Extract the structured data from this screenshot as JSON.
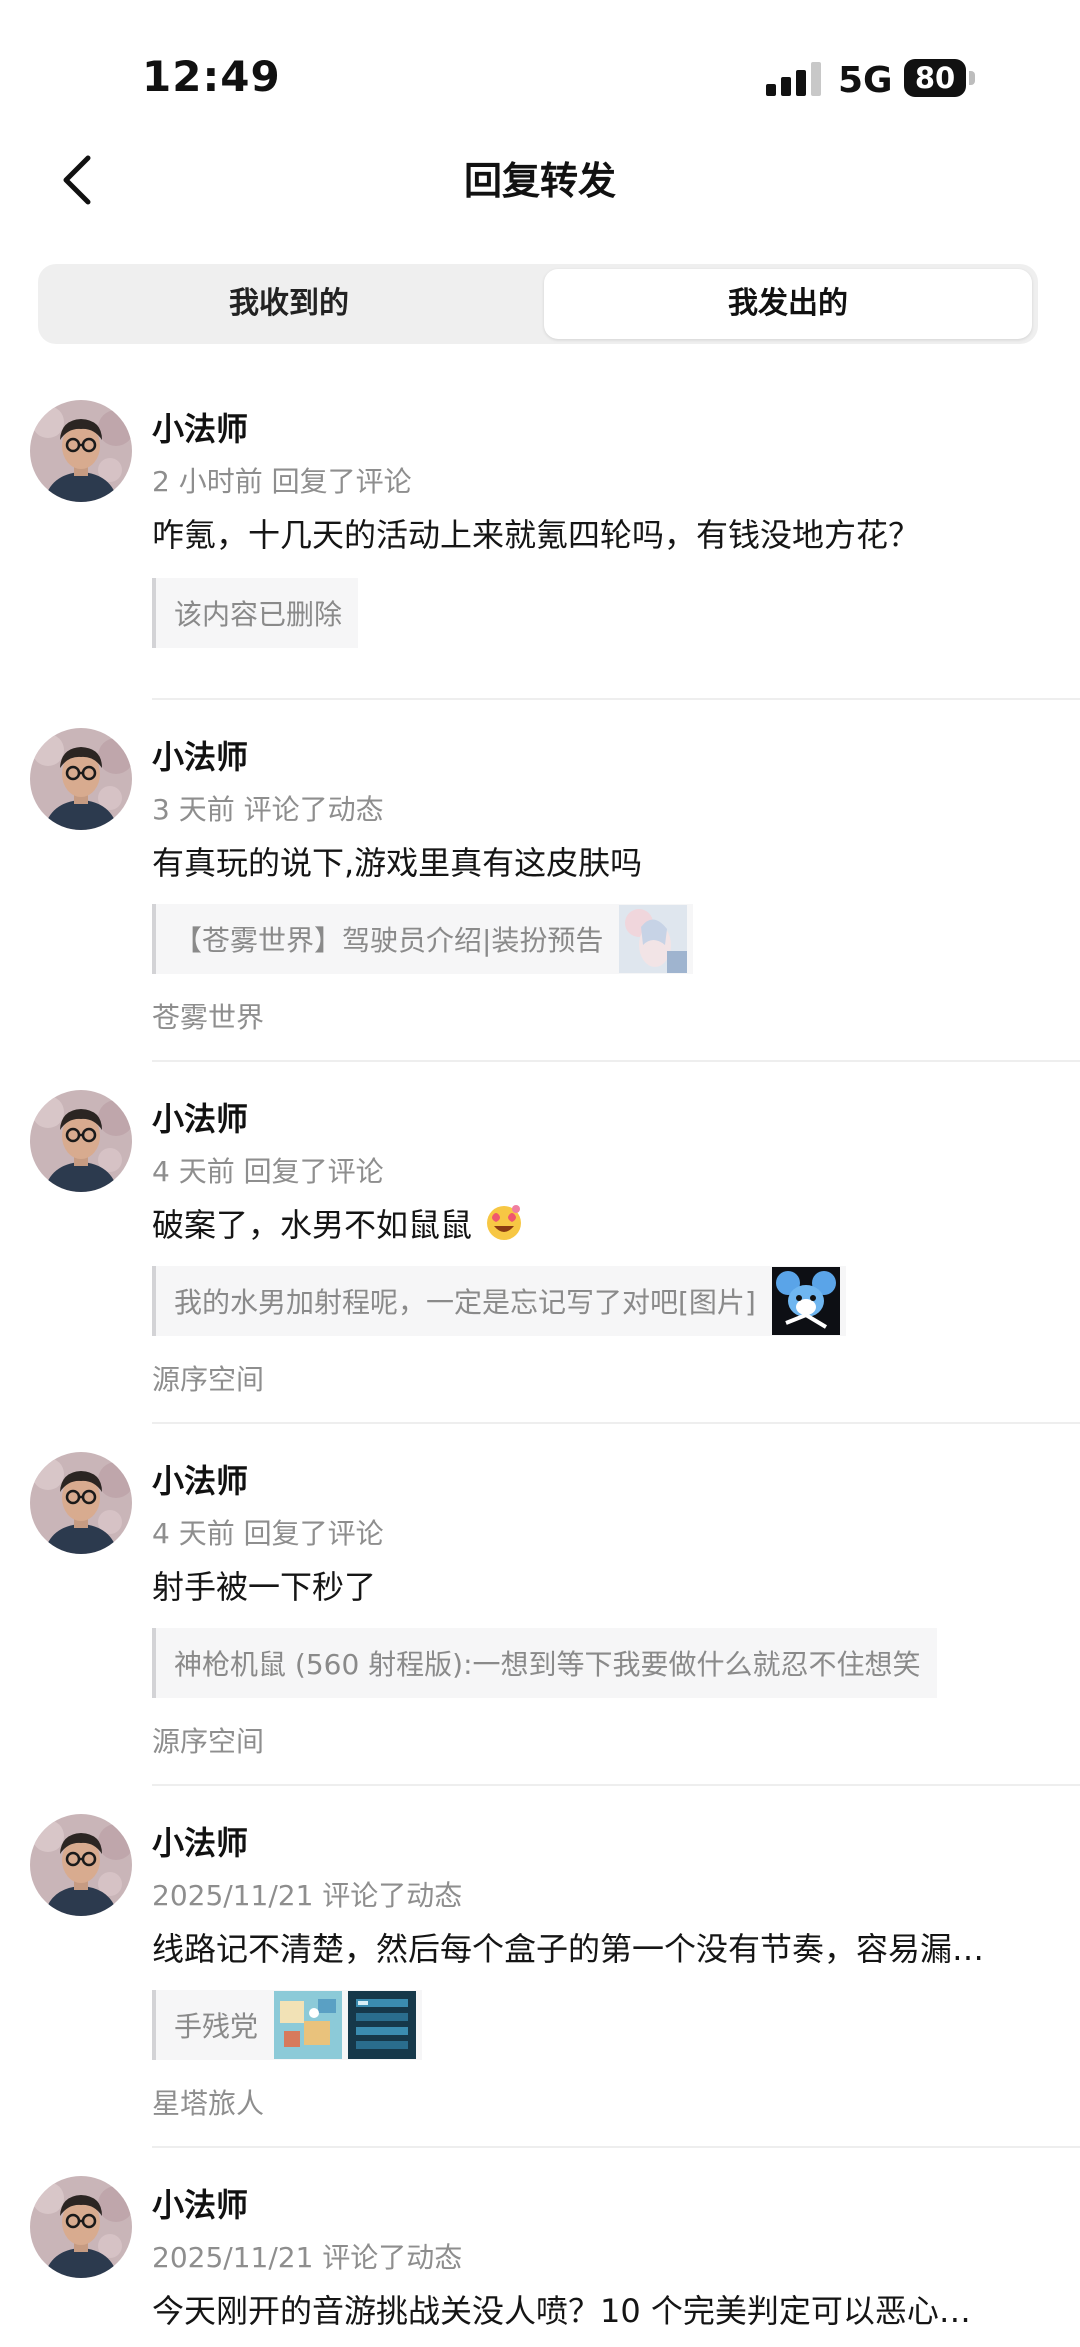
{
  "status_bar": {
    "time": "12:49",
    "network": "5G",
    "battery": "80"
  },
  "nav": {
    "title": "回复转发",
    "back_icon": "chevron-left-icon"
  },
  "tabs": [
    {
      "label": "我收到的",
      "selected": false
    },
    {
      "label": "我发出的",
      "selected": true
    }
  ],
  "items": [
    {
      "name": "小法师",
      "meta": "2 小时前 回复了评论",
      "content": "咋氪，十几天的活动上来就氪四轮吗，有钱没地方花？",
      "quote": "该内容已删除",
      "source": ""
    },
    {
      "name": "小法师",
      "meta": "3 天前 评论了动态",
      "content": "有真玩的说下,游戏里真有这皮肤吗",
      "quote": "【苍雾世界】驾驶员介绍|装扮预告",
      "source": "苍雾世界"
    },
    {
      "name": "小法师",
      "meta": "4 天前 回复了评论",
      "content": "破案了，水男不如鼠鼠",
      "emoji": "heart-eyes-emoji",
      "quote": "我的水男加射程呢，一定是忘记写了对吧[图片]",
      "source": "源序空间"
    },
    {
      "name": "小法师",
      "meta": "4 天前 回复了评论",
      "content": "射手被一下秒了",
      "quote": "神枪机鼠 (560 射程版):一想到等下我要做什么就忍不住想笑",
      "source": "源序空间"
    },
    {
      "name": "小法师",
      "meta": "2025/11/21 评论了动态",
      "content": "线路记不清楚，然后每个盒子的第一个没有节奏，容易漏…",
      "quote": "手残党",
      "source": "星塔旅人"
    },
    {
      "name": "小法师",
      "meta": "2025/11/21 评论了动态",
      "content": "今天刚开的音游挑战关没人喷？10 个完美判定可以恶心…",
      "quote": "",
      "source": ""
    }
  ],
  "colors": {
    "accent_text": "#111111",
    "secondary_text": "#8e8e8e",
    "quote_bg": "#f6f6f7"
  }
}
